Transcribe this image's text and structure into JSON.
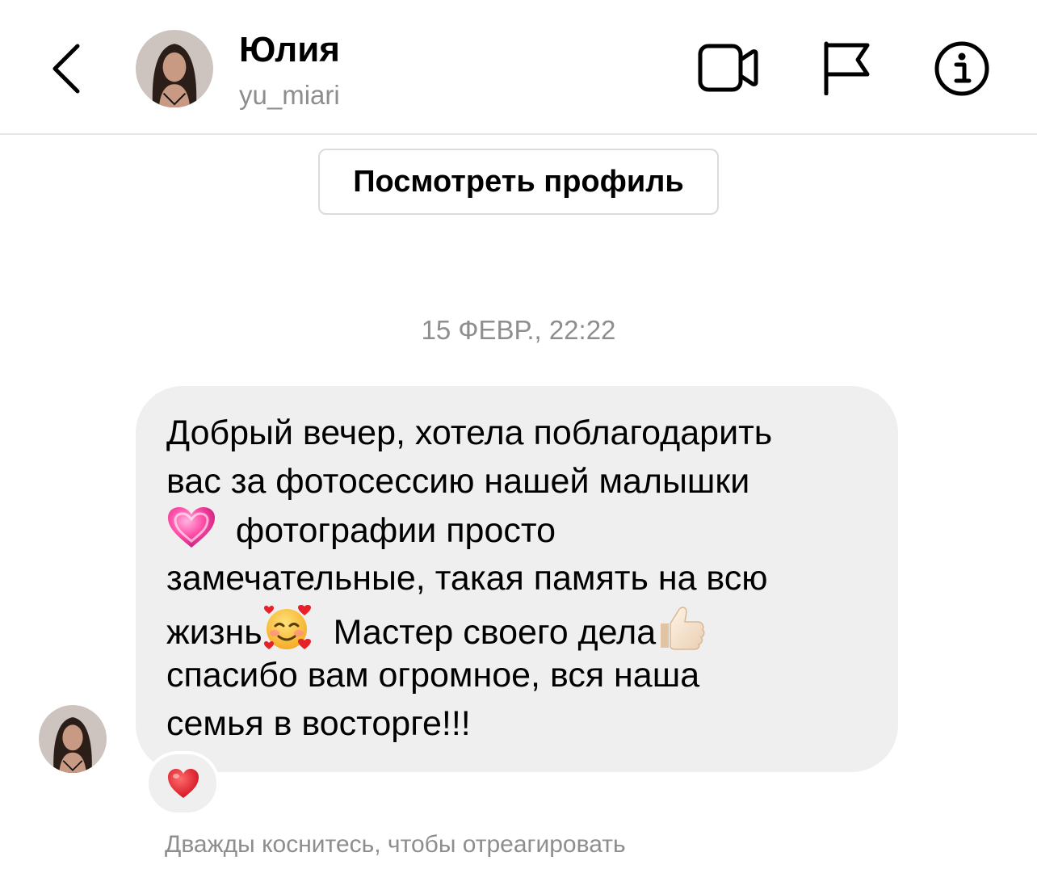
{
  "header": {
    "name": "Юлия",
    "username": "yu_miari",
    "icons": [
      "back-chevron-icon",
      "video-call-icon",
      "report-flag-icon",
      "info-icon"
    ]
  },
  "view_profile_label": "Посмотреть профиль",
  "thread": {
    "timestamp": "15 ФЕВР., 22:22",
    "message_lines": [
      "Добрый вечер, хотела поблагодарить",
      "вас за фотосессию нашей малышки",
      "фотографии просто",
      "замечательные, такая память на всю",
      "жизнь",
      "Мастер своего дела",
      "спасибо вам огромное, вся наша",
      "семья в восторге!!!"
    ],
    "inline_emoji": [
      "growing-heart-emoji",
      "smiling-face-with-hearts-emoji",
      "thumbs-up-emoji"
    ],
    "reaction": "red-heart-emoji",
    "hint": "Дважды коснитесь, чтобы отреагировать"
  },
  "colors": {
    "secondary_text": "#8e8e8e",
    "bubble_bg": "#efefef",
    "divider": "#e6e6e6",
    "heart_red": "#e0232e"
  }
}
